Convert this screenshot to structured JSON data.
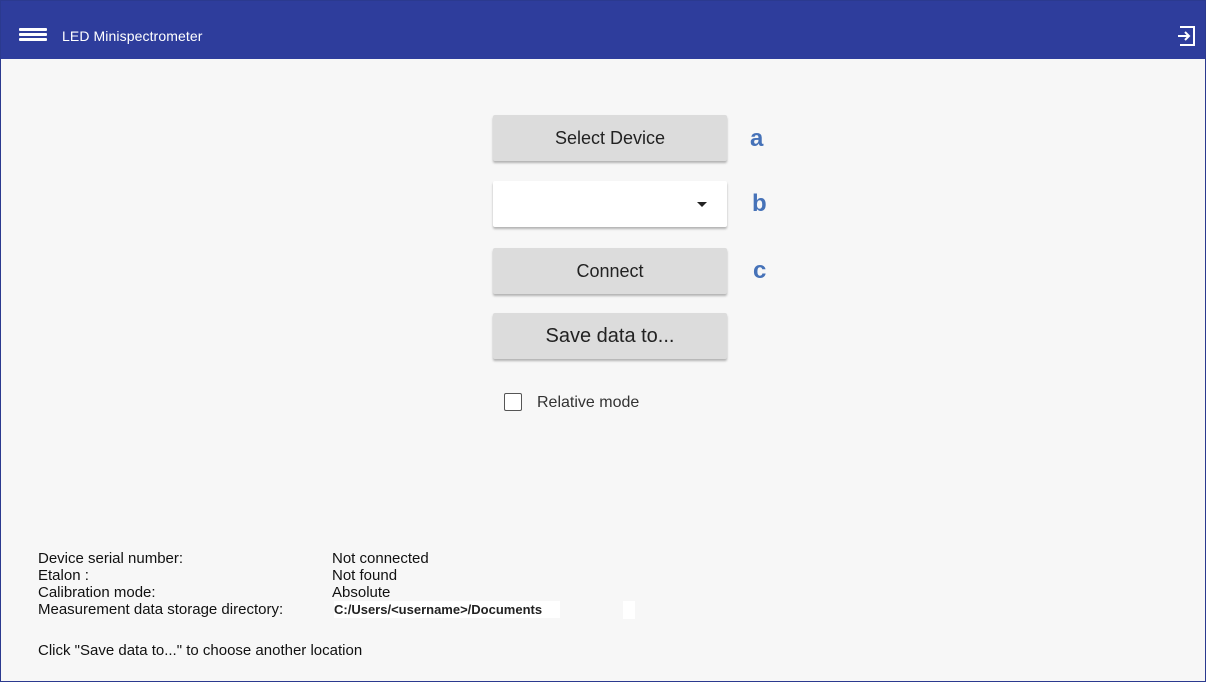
{
  "header": {
    "menu_icon": "hamburger-menu-icon",
    "title": "LED Minispectrometer",
    "exit_icon": "exit-icon",
    "background_color": "#2e3d9c"
  },
  "controls": {
    "select_device_label": "Select Device",
    "device_dropdown_value": "",
    "connect_label": "Connect",
    "save_data_label": "Save data to...",
    "relative_mode_label": "Relative mode",
    "relative_mode_checked": false
  },
  "annotations": {
    "a": "a",
    "b": "b",
    "c": "c",
    "color": "#4672b8"
  },
  "info": {
    "serial_label": "Device serial number:",
    "serial_value": "Not connected",
    "etalon_label": "Etalon :",
    "etalon_value": "Not found",
    "calibration_label": "Calibration mode:",
    "calibration_value": "Absolute",
    "storage_label": "Measurement data storage directory:",
    "storage_value": "C:/Users/<username>/Documents",
    "hint": "Click \"Save data to...\" to choose another location"
  }
}
